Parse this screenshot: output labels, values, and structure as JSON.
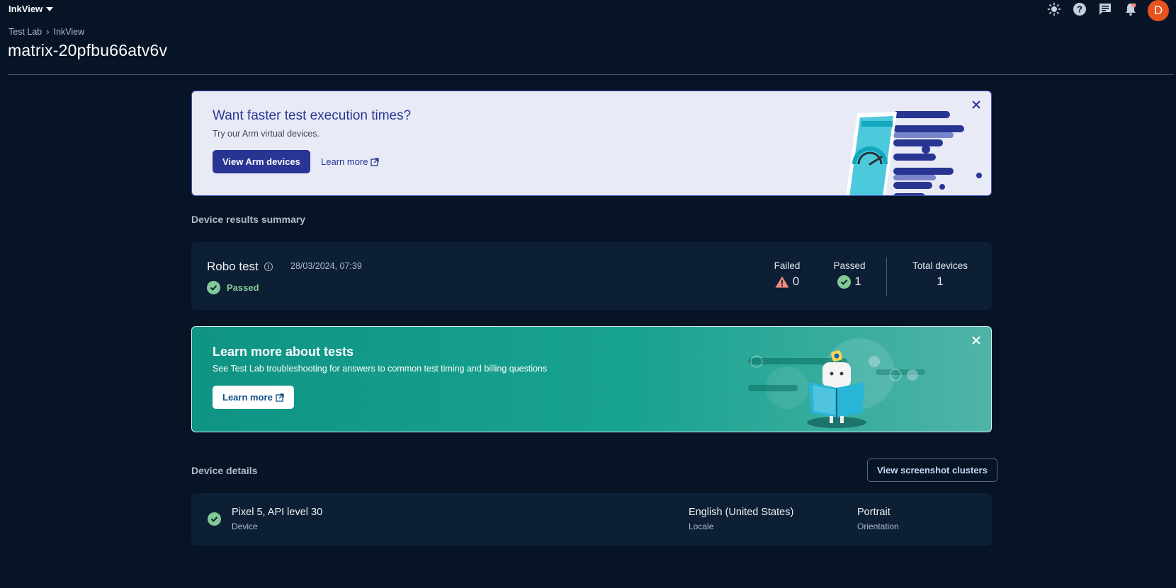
{
  "app": {
    "project_name": "InkView"
  },
  "breadcrumb": {
    "items": [
      "Test Lab",
      "InkView"
    ]
  },
  "page": {
    "title": "matrix-20pfbu66atv6v"
  },
  "top_icons": [
    "theme-icon",
    "help-icon",
    "feedback-icon",
    "notifications-icon"
  ],
  "avatar_initial": "D",
  "promo": {
    "title": "Want faster test execution times?",
    "subtitle": "Try our Arm virtual devices.",
    "primary_button": "View Arm devices",
    "link_label": "Learn more"
  },
  "summary": {
    "heading": "Device results summary",
    "test_name": "Robo test",
    "timestamp": "28/03/2024, 07:39",
    "status": "Passed",
    "stats": {
      "failed_label": "Failed",
      "failed_value": "0",
      "passed_label": "Passed",
      "passed_value": "1",
      "total_label": "Total devices",
      "total_value": "1"
    }
  },
  "learn_banner": {
    "title": "Learn more about tests",
    "subtitle": "See Test Lab troubleshooting for answers to common test timing and billing questions",
    "button": "Learn more"
  },
  "device_details": {
    "heading": "Device details",
    "clusters_button": "View screenshot clusters",
    "device": {
      "name": "Pixel 5, API level 30",
      "name_label": "Device",
      "locale": "English (United States)",
      "locale_label": "Locale",
      "orientation": "Portrait",
      "orientation_label": "Orientation"
    }
  },
  "colors": {
    "background": "#061426",
    "card": "#0d1f35",
    "accent_indigo": "#283593",
    "success": "#81c995",
    "warning": "#f28b82",
    "teal": "#12998a",
    "avatar": "#e8531b"
  }
}
